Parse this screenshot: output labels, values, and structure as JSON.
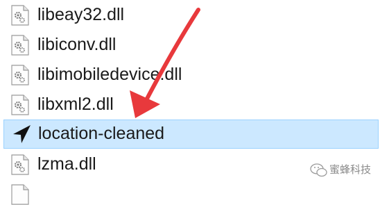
{
  "files": [
    {
      "name": "libeay32.dll",
      "icon": "dll-file-icon",
      "selected": false
    },
    {
      "name": "libiconv.dll",
      "icon": "dll-file-icon",
      "selected": false
    },
    {
      "name": "libimobiledevice.dll",
      "icon": "dll-file-icon",
      "selected": false
    },
    {
      "name": "libxml2.dll",
      "icon": "dll-file-icon",
      "selected": false
    },
    {
      "name": "location-cleaned",
      "icon": "location-arrow-icon",
      "selected": true
    },
    {
      "name": "lzma.dll",
      "icon": "dll-file-icon",
      "selected": false
    }
  ],
  "annotation": {
    "color": "#e8393c"
  },
  "selection": {
    "background": "#cce8ff",
    "border": "#99d1ff"
  },
  "watermark": {
    "text": "蜜蜂科技",
    "icon": "wechat-logo-icon"
  }
}
